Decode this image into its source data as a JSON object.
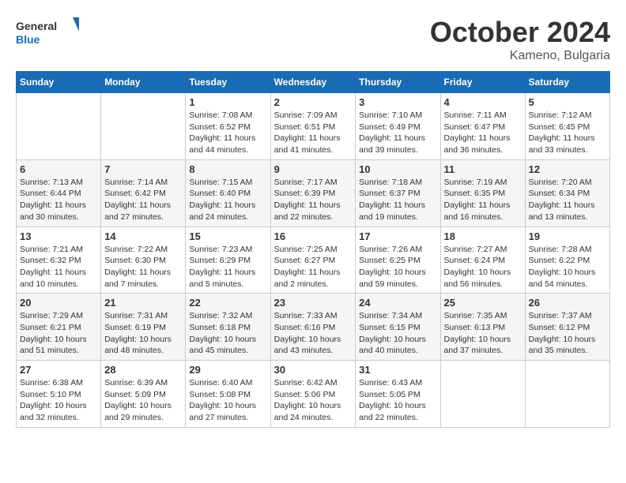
{
  "header": {
    "logo_line1": "General",
    "logo_line2": "Blue",
    "month": "October 2024",
    "location": "Kameno, Bulgaria"
  },
  "weekdays": [
    "Sunday",
    "Monday",
    "Tuesday",
    "Wednesday",
    "Thursday",
    "Friday",
    "Saturday"
  ],
  "weeks": [
    [
      {
        "day": "",
        "info": ""
      },
      {
        "day": "",
        "info": ""
      },
      {
        "day": "1",
        "info": "Sunrise: 7:08 AM\nSunset: 6:52 PM\nDaylight: 11 hours and 44 minutes."
      },
      {
        "day": "2",
        "info": "Sunrise: 7:09 AM\nSunset: 6:51 PM\nDaylight: 11 hours and 41 minutes."
      },
      {
        "day": "3",
        "info": "Sunrise: 7:10 AM\nSunset: 6:49 PM\nDaylight: 11 hours and 39 minutes."
      },
      {
        "day": "4",
        "info": "Sunrise: 7:11 AM\nSunset: 6:47 PM\nDaylight: 11 hours and 36 minutes."
      },
      {
        "day": "5",
        "info": "Sunrise: 7:12 AM\nSunset: 6:45 PM\nDaylight: 11 hours and 33 minutes."
      }
    ],
    [
      {
        "day": "6",
        "info": "Sunrise: 7:13 AM\nSunset: 6:44 PM\nDaylight: 11 hours and 30 minutes."
      },
      {
        "day": "7",
        "info": "Sunrise: 7:14 AM\nSunset: 6:42 PM\nDaylight: 11 hours and 27 minutes."
      },
      {
        "day": "8",
        "info": "Sunrise: 7:15 AM\nSunset: 6:40 PM\nDaylight: 11 hours and 24 minutes."
      },
      {
        "day": "9",
        "info": "Sunrise: 7:17 AM\nSunset: 6:39 PM\nDaylight: 11 hours and 22 minutes."
      },
      {
        "day": "10",
        "info": "Sunrise: 7:18 AM\nSunset: 6:37 PM\nDaylight: 11 hours and 19 minutes."
      },
      {
        "day": "11",
        "info": "Sunrise: 7:19 AM\nSunset: 6:35 PM\nDaylight: 11 hours and 16 minutes."
      },
      {
        "day": "12",
        "info": "Sunrise: 7:20 AM\nSunset: 6:34 PM\nDaylight: 11 hours and 13 minutes."
      }
    ],
    [
      {
        "day": "13",
        "info": "Sunrise: 7:21 AM\nSunset: 6:32 PM\nDaylight: 11 hours and 10 minutes."
      },
      {
        "day": "14",
        "info": "Sunrise: 7:22 AM\nSunset: 6:30 PM\nDaylight: 11 hours and 7 minutes."
      },
      {
        "day": "15",
        "info": "Sunrise: 7:23 AM\nSunset: 6:29 PM\nDaylight: 11 hours and 5 minutes."
      },
      {
        "day": "16",
        "info": "Sunrise: 7:25 AM\nSunset: 6:27 PM\nDaylight: 11 hours and 2 minutes."
      },
      {
        "day": "17",
        "info": "Sunrise: 7:26 AM\nSunset: 6:25 PM\nDaylight: 10 hours and 59 minutes."
      },
      {
        "day": "18",
        "info": "Sunrise: 7:27 AM\nSunset: 6:24 PM\nDaylight: 10 hours and 56 minutes."
      },
      {
        "day": "19",
        "info": "Sunrise: 7:28 AM\nSunset: 6:22 PM\nDaylight: 10 hours and 54 minutes."
      }
    ],
    [
      {
        "day": "20",
        "info": "Sunrise: 7:29 AM\nSunset: 6:21 PM\nDaylight: 10 hours and 51 minutes."
      },
      {
        "day": "21",
        "info": "Sunrise: 7:31 AM\nSunset: 6:19 PM\nDaylight: 10 hours and 48 minutes."
      },
      {
        "day": "22",
        "info": "Sunrise: 7:32 AM\nSunset: 6:18 PM\nDaylight: 10 hours and 45 minutes."
      },
      {
        "day": "23",
        "info": "Sunrise: 7:33 AM\nSunset: 6:16 PM\nDaylight: 10 hours and 43 minutes."
      },
      {
        "day": "24",
        "info": "Sunrise: 7:34 AM\nSunset: 6:15 PM\nDaylight: 10 hours and 40 minutes."
      },
      {
        "day": "25",
        "info": "Sunrise: 7:35 AM\nSunset: 6:13 PM\nDaylight: 10 hours and 37 minutes."
      },
      {
        "day": "26",
        "info": "Sunrise: 7:37 AM\nSunset: 6:12 PM\nDaylight: 10 hours and 35 minutes."
      }
    ],
    [
      {
        "day": "27",
        "info": "Sunrise: 6:38 AM\nSunset: 5:10 PM\nDaylight: 10 hours and 32 minutes."
      },
      {
        "day": "28",
        "info": "Sunrise: 6:39 AM\nSunset: 5:09 PM\nDaylight: 10 hours and 29 minutes."
      },
      {
        "day": "29",
        "info": "Sunrise: 6:40 AM\nSunset: 5:08 PM\nDaylight: 10 hours and 27 minutes."
      },
      {
        "day": "30",
        "info": "Sunrise: 6:42 AM\nSunset: 5:06 PM\nDaylight: 10 hours and 24 minutes."
      },
      {
        "day": "31",
        "info": "Sunrise: 6:43 AM\nSunset: 5:05 PM\nDaylight: 10 hours and 22 minutes."
      },
      {
        "day": "",
        "info": ""
      },
      {
        "day": "",
        "info": ""
      }
    ]
  ]
}
